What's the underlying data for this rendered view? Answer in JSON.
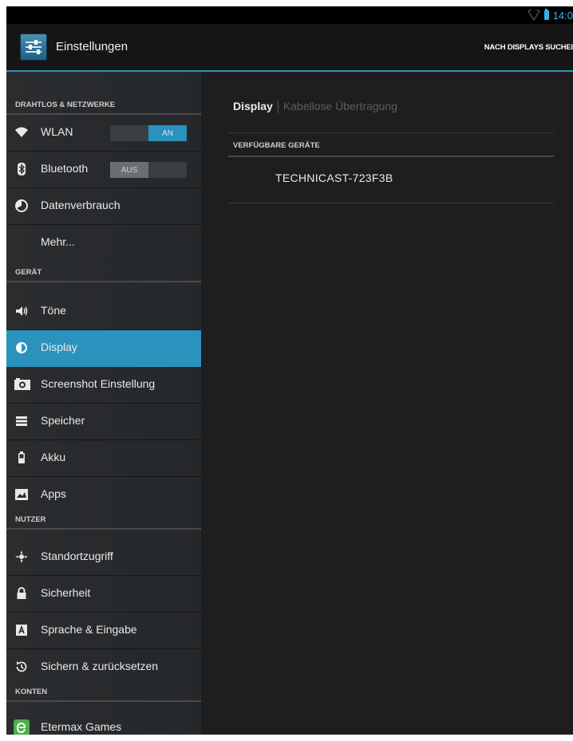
{
  "status_bar": {
    "time": "14:0"
  },
  "action_bar": {
    "title": "Einstellungen",
    "search_action": "NACH DISPLAYS SUCHEI"
  },
  "sidebar": {
    "sections": {
      "wireless": "DRAHTLOS & NETZWERKE",
      "device": "GERÄT",
      "user": "NUTZER",
      "accounts": "KONTEN"
    },
    "items": [
      {
        "label": "WLAN",
        "icon": "wifi-icon",
        "toggle": "AN"
      },
      {
        "label": "Bluetooth",
        "icon": "bluetooth-icon",
        "toggle": "AUS"
      },
      {
        "label": "Datenverbrauch",
        "icon": "data-usage-icon"
      },
      {
        "label": "Mehr...",
        "icon": ""
      },
      {
        "label": "Töne",
        "icon": "volume-icon"
      },
      {
        "label": "Display",
        "icon": "display-icon",
        "selected": true
      },
      {
        "label": "Screenshot Einstellung",
        "icon": "camera-icon"
      },
      {
        "label": "Speicher",
        "icon": "storage-icon"
      },
      {
        "label": "Akku",
        "icon": "battery-icon"
      },
      {
        "label": "Apps",
        "icon": "apps-icon"
      },
      {
        "label": "Standortzugriff",
        "icon": "location-icon"
      },
      {
        "label": "Sicherheit",
        "icon": "lock-icon"
      },
      {
        "label": "Sprache & Eingabe",
        "icon": "keyboard-icon"
      },
      {
        "label": "Sichern & zurücksetzen",
        "icon": "backup-icon"
      },
      {
        "label": "Etermax Games",
        "icon": "etermax-icon"
      }
    ]
  },
  "content": {
    "tabs": [
      {
        "label": "Display"
      },
      {
        "label": "Kabellose Übertragung"
      }
    ],
    "section_header": "VERFÜGBARE GERÄTE",
    "devices": [
      "TECHNICAST-723F3B"
    ]
  },
  "colors": {
    "accent": "#2b92bd",
    "clock": "#33b5e5",
    "background": "#1e1e1e",
    "sidebar": "#2a2c2e"
  }
}
